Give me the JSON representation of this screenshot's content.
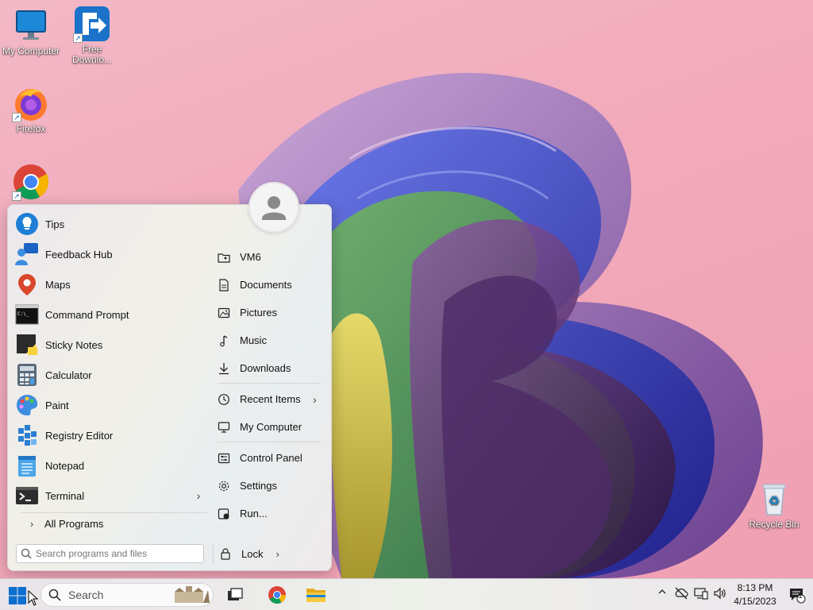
{
  "desktop": {
    "icons": [
      {
        "label": "My Computer",
        "icon": "monitor-icon"
      },
      {
        "label": "Free Downlo...",
        "icon": "free-download-manager-icon"
      },
      {
        "label": "Firefox",
        "icon": "firefox-icon"
      },
      {
        "label": "",
        "icon": "chrome-icon"
      },
      {
        "label": "Recycle Bin",
        "icon": "recycle-bin-icon"
      }
    ]
  },
  "start_menu": {
    "programs": [
      {
        "label": "Tips",
        "icon": "tips-icon"
      },
      {
        "label": "Feedback Hub",
        "icon": "feedback-hub-icon"
      },
      {
        "label": "Maps",
        "icon": "maps-icon"
      },
      {
        "label": "Command Prompt",
        "icon": "command-prompt-icon"
      },
      {
        "label": "Sticky Notes",
        "icon": "sticky-notes-icon"
      },
      {
        "label": "Calculator",
        "icon": "calculator-icon"
      },
      {
        "label": "Paint",
        "icon": "paint-icon"
      },
      {
        "label": "Registry Editor",
        "icon": "registry-editor-icon"
      },
      {
        "label": "Notepad",
        "icon": "notepad-icon"
      },
      {
        "label": "Terminal",
        "icon": "terminal-icon",
        "submenu": "›"
      }
    ],
    "all_programs": "All Programs",
    "search_placeholder": "Search programs and files",
    "places": [
      {
        "label": "VM6",
        "icon": "user-folder-icon"
      },
      {
        "label": "Documents",
        "icon": "documents-icon"
      },
      {
        "label": "Pictures",
        "icon": "pictures-icon"
      },
      {
        "label": "Music",
        "icon": "music-icon"
      },
      {
        "label": "Downloads",
        "icon": "downloads-icon"
      },
      {
        "label": "Recent Items",
        "icon": "recent-items-icon",
        "submenu": "›"
      },
      {
        "label": "My Computer",
        "icon": "computer-icon"
      },
      {
        "label": "Control Panel",
        "icon": "control-panel-icon"
      },
      {
        "label": "Settings",
        "icon": "settings-gear-icon"
      },
      {
        "label": "Run...",
        "icon": "run-icon"
      }
    ],
    "lock_label": "Lock",
    "lock_arrow": "›"
  },
  "taskbar": {
    "search_label": "Search",
    "time": "8:13 PM",
    "date": "4/15/2023",
    "notification_count": "1"
  },
  "colors": {
    "accent": "#0067c0",
    "wallpaper_pink": "#f2aabb"
  }
}
